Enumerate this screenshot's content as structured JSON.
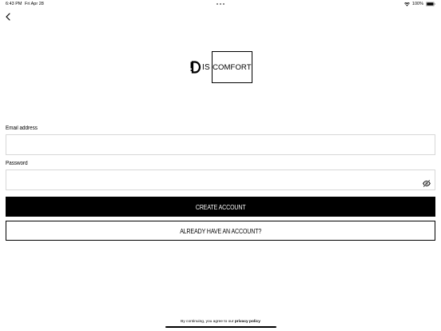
{
  "status_bar": {
    "time": "6:43 PM",
    "date": "Fri Apr 28",
    "battery": "100%"
  },
  "icons": {
    "back": "chevron-left-icon",
    "wifi": "wifi-icon",
    "battery": "battery-icon",
    "password_toggle": "eye-slash-icon"
  },
  "logo": {
    "d": "D",
    "dis": "IS",
    "box_text": "COMFORT"
  },
  "form": {
    "email_label": "Email address",
    "email_value": "",
    "password_label": "Password",
    "password_value": ""
  },
  "buttons": {
    "create_account": "CREATE ACCOUNT",
    "already_have_account": "ALREADY HAVE AN ACCOUNT?"
  },
  "footer": {
    "prefix": "By continuing, you agree to our",
    "policy_link": "privacy policy"
  }
}
